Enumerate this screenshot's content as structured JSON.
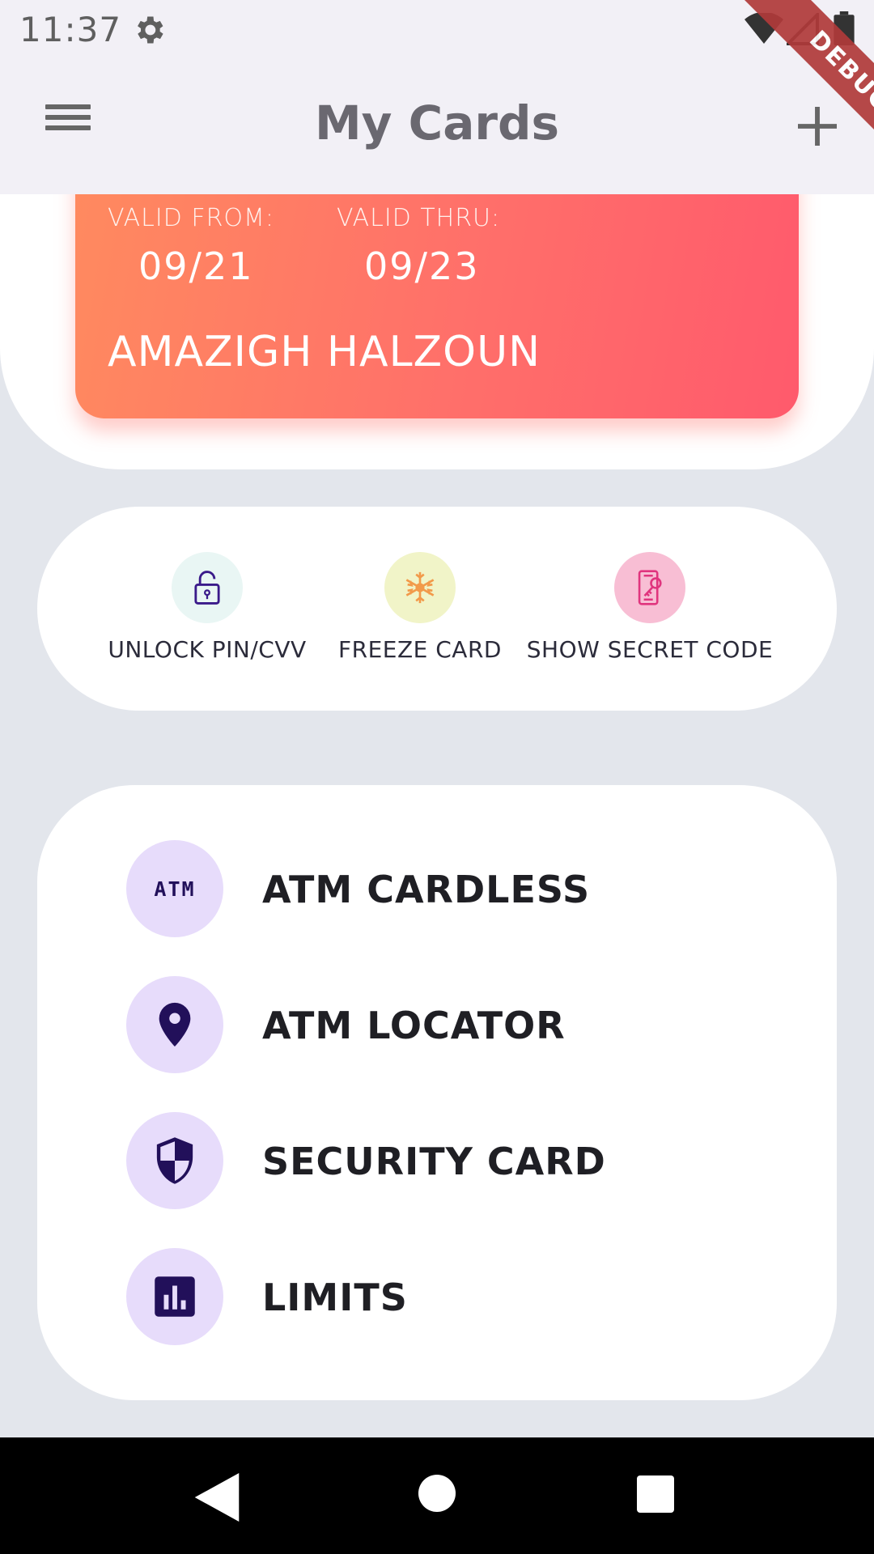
{
  "status_bar": {
    "time": "11:37",
    "icons": [
      "gear-icon",
      "wifi-icon",
      "signal-icon",
      "battery-icon"
    ]
  },
  "app_bar": {
    "title": "My Cards",
    "menu_icon": "hamburger-menu-icon",
    "add_icon": "plus-icon"
  },
  "debug_banner": "DEBUG",
  "card": {
    "valid_from_label": "VALID FROM:",
    "valid_from": "09/21",
    "valid_thru_label": "VALID THRU:",
    "valid_thru": "09/23",
    "holder": "AMAZIGH HALZOUN",
    "gradient_start": "#ff8a5f",
    "gradient_end": "#ff5a6c"
  },
  "quick_actions": [
    {
      "label": "UNLOCK PIN/CVV",
      "icon": "padlock-icon",
      "color": "#e9f6f4"
    },
    {
      "label": "FREEZE CARD",
      "icon": "snowflake-icon",
      "color": "#f1f4c8"
    },
    {
      "label": "SHOW SECRET CODE",
      "icon": "secret-key-icon",
      "color": "#f8bed4"
    }
  ],
  "services": [
    {
      "label": "ATM CARDLESS",
      "icon": "atm-icon",
      "icon_text": "ATM"
    },
    {
      "label": "ATM LOCATOR",
      "icon": "location-pin-icon"
    },
    {
      "label": "SECURITY CARD",
      "icon": "shield-icon"
    },
    {
      "label": "LIMITS",
      "icon": "bar-chart-icon"
    }
  ],
  "colors": {
    "accent_dark": "#22105a",
    "service_icon_bg": "#e7dcfb",
    "background": "#e3e6ec"
  },
  "nav_bar": {
    "icons": [
      "back-icon",
      "home-icon",
      "recents-icon"
    ]
  }
}
